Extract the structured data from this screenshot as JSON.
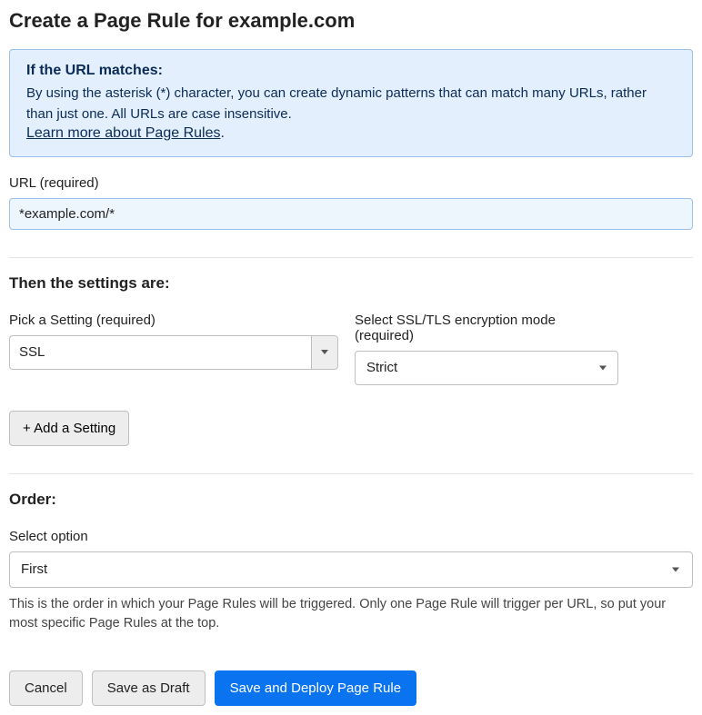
{
  "header": {
    "title": "Create a Page Rule for example.com"
  },
  "info": {
    "heading": "If the URL matches:",
    "body": "By using the asterisk (*) character, you can create dynamic patterns that can match many URLs, rather than just one. All URLs are case insensitive.",
    "link_text": "Learn more about Page Rules",
    "period": "."
  },
  "url_field": {
    "label": "URL (required)",
    "value": "*example.com/*"
  },
  "settings": {
    "heading": "Then the settings are:",
    "pick_label": "Pick a Setting (required)",
    "pick_value": "SSL",
    "ssl_label": "Select SSL/TLS encryption mode (required)",
    "ssl_value": "Strict",
    "add_label": "+ Add a Setting"
  },
  "order": {
    "heading": "Order:",
    "select_label": "Select option",
    "select_value": "First",
    "help": "This is the order in which your Page Rules will be triggered. Only one Page Rule will trigger per URL, so put your most specific Page Rules at the top."
  },
  "buttons": {
    "cancel": "Cancel",
    "draft": "Save as Draft",
    "deploy": "Save and Deploy Page Rule"
  }
}
